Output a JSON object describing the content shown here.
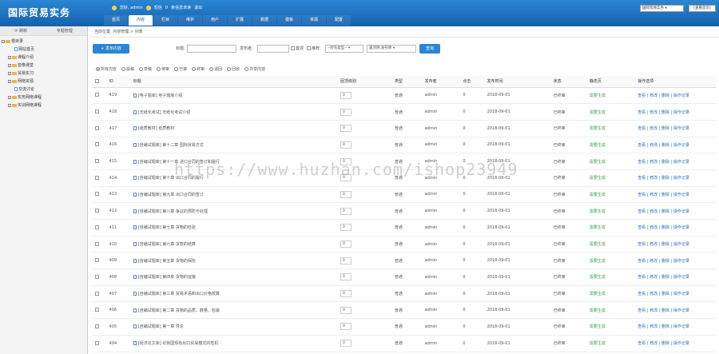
{
  "header": {
    "logo": "国际贸易实务",
    "user_label": "您好, admin",
    "messages": "短信",
    "no_unread": "0",
    "unread": "条信息未读",
    "logout": "退出",
    "site_select": "国际贸易实务",
    "site_home": "[查看首页]"
  },
  "nav": [
    "首页",
    "内容",
    "栏目",
    "维护",
    "用户",
    "扩展",
    "数据",
    "模板",
    "资源",
    "配置"
  ],
  "sidebar": {
    "refresh": "刷新",
    "expand_mgmt": "专题管理",
    "tree": [
      {
        "label": "根目录",
        "level": 0,
        "type": "folder"
      },
      {
        "label": "网站首页",
        "level": 2,
        "type": "page"
      },
      {
        "label": "课程介绍",
        "level": 1,
        "type": "folder"
      },
      {
        "label": "音像课堂",
        "level": 1,
        "type": "folder"
      },
      {
        "label": "贸易实习",
        "level": 1,
        "type": "folder"
      },
      {
        "label": "网络资源",
        "level": 1,
        "type": "folder"
      },
      {
        "label": "交流讨论",
        "level": 2,
        "type": "page"
      },
      {
        "label": "实务网络课程",
        "level": 1,
        "type": "folder"
      },
      {
        "label": "实训网络课程",
        "level": 1,
        "type": "folder"
      }
    ]
  },
  "breadcrumb": "当前位置: 内容管理 > 列表",
  "toolbar": {
    "add": "+ 发布内容",
    "title_label": "标题:",
    "author_label": "发布者:",
    "top": "置顶",
    "recommend": "推荐",
    "type_select": "--所有类型--",
    "order_select": "置顶降,发布降",
    "search": "查询"
  },
  "filters": [
    "所有内容",
    "投稿",
    "草稿",
    "待审",
    "已审",
    "终审",
    "退回",
    "回收",
    "共享内容"
  ],
  "columns": [
    "",
    "ID",
    "标题",
    "固顶级别",
    "类型",
    "发布者",
    "点击",
    "发布时间",
    "状态",
    "静态页",
    "操作选项"
  ],
  "rows": [
    {
      "id": "419",
      "title": "[电子题库] 电子题库介绍",
      "order": "0",
      "type": "普通",
      "author": "admin",
      "hits": "0",
      "date": "2018-09-01",
      "status": "已终审",
      "static": "需要生成",
      "ops": "查看 | 修改 | 删除 | 操作记录"
    },
    {
      "id": "418",
      "title": "[无纸化考试] 无纸化考试介绍",
      "order": "0",
      "type": "普通",
      "author": "admin",
      "hits": "0",
      "date": "2018-09-01",
      "status": "已终审",
      "static": "需要生成",
      "ops": "查看 | 修改 | 删除 | 操作记录"
    },
    {
      "id": "417",
      "title": "[纸质教材] 纸质教材",
      "order": "0",
      "type": "普通",
      "author": "admin",
      "hits": "0",
      "date": "2018-09-01",
      "status": "已终审",
      "static": "需要生成",
      "ops": "查看 | 修改 | 删除 | 操作记录"
    },
    {
      "id": "416",
      "title": "[自编试题库] 第十二章 国际贸易方式",
      "order": "0",
      "type": "普通",
      "author": "admin",
      "hits": "0",
      "date": "2018-09-01",
      "status": "已终审",
      "static": "需要生成",
      "ops": "查看 | 修改 | 删除 | 操作记录"
    },
    {
      "id": "415",
      "title": "[自编试题库] 第十一章 进口合同的签订和履行",
      "order": "0",
      "type": "普通",
      "author": "admin",
      "hits": "0",
      "date": "2018-09-01",
      "status": "已终审",
      "static": "需要生成",
      "ops": "查看 | 修改 | 删除 | 操作记录"
    },
    {
      "id": "414",
      "title": "[自编试题库] 第十章 出口合同的履行",
      "order": "0",
      "type": "普通",
      "author": "admin",
      "hits": "0",
      "date": "2018-09-01",
      "status": "已终审",
      "static": "需要生成",
      "ops": "查看 | 修改 | 删除 | 操作记录"
    },
    {
      "id": "413",
      "title": "[自编试题库] 第九章 出口合同的签订",
      "order": "0",
      "type": "普通",
      "author": "admin",
      "hits": "0",
      "date": "2018-09-01",
      "status": "已终审",
      "static": "需要生成",
      "ops": "查看 | 修改 | 删除 | 操作记录"
    },
    {
      "id": "412",
      "title": "[自编试题库] 第八章 争议的预防与处理",
      "order": "0",
      "type": "普通",
      "author": "admin",
      "hits": "0",
      "date": "2018-09-01",
      "status": "已终审",
      "static": "需要生成",
      "ops": "查看 | 修改 | 删除 | 操作记录"
    },
    {
      "id": "411",
      "title": "[自编试题库] 第七章 货物的检验",
      "order": "0",
      "type": "普通",
      "author": "admin",
      "hits": "0",
      "date": "2018-09-01",
      "status": "已终审",
      "static": "需要生成",
      "ops": "查看 | 修改 | 删除 | 操作记录"
    },
    {
      "id": "410",
      "title": "[自编试题库] 第六章 货款的结算",
      "order": "0",
      "type": "普通",
      "author": "admin",
      "hits": "0",
      "date": "2018-09-01",
      "status": "已终审",
      "static": "需要生成",
      "ops": "查看 | 修改 | 删除 | 操作记录"
    },
    {
      "id": "409",
      "title": "[自编试题库] 第五章 货物的保险",
      "order": "0",
      "type": "普通",
      "author": "admin",
      "hits": "0",
      "date": "2018-09-01",
      "status": "已终审",
      "static": "需要生成",
      "ops": "查看 | 修改 | 删除 | 操作记录"
    },
    {
      "id": "408",
      "title": "[自编试题库] 第四章 货物的运输",
      "order": "0",
      "type": "普通",
      "author": "admin",
      "hits": "0",
      "date": "2018-09-01",
      "status": "已终审",
      "static": "需要生成",
      "ops": "查看 | 修改 | 删除 | 操作记录"
    },
    {
      "id": "407",
      "title": "[自编试题库] 第三章 贸易术语和出口价格核算",
      "order": "0",
      "type": "普通",
      "author": "admin",
      "hits": "0",
      "date": "2018-09-01",
      "status": "已终审",
      "static": "需要生成",
      "ops": "查看 | 修改 | 删除 | 操作记录"
    },
    {
      "id": "406",
      "title": "[自编试题库] 第二章 货物的品质、数量、包装",
      "order": "0",
      "type": "普通",
      "author": "admin",
      "hits": "0",
      "date": "2018-09-01",
      "status": "已终审",
      "static": "需要生成",
      "ops": "查看 | 修改 | 删除 | 操作记录"
    },
    {
      "id": "405",
      "title": "[自编试题库] 第一章 导论",
      "order": "0",
      "type": "普通",
      "author": "admin",
      "hits": "0",
      "date": "2018-09-01",
      "status": "已终审",
      "static": "需要生成",
      "ops": "查看 | 修改 | 删除 | 操作记录"
    },
    {
      "id": "404",
      "title": "[经济论文库] 论我国现有出口贸易模式的危机",
      "order": "0",
      "type": "普通",
      "author": "admin",
      "hits": "0",
      "date": "2018-09-01",
      "status": "已终审",
      "static": "需要生成",
      "ops": "查看 | 修改 | 删除 | 操作记录"
    }
  ],
  "watermark": "https://www.huzhan.com/ishop23949"
}
